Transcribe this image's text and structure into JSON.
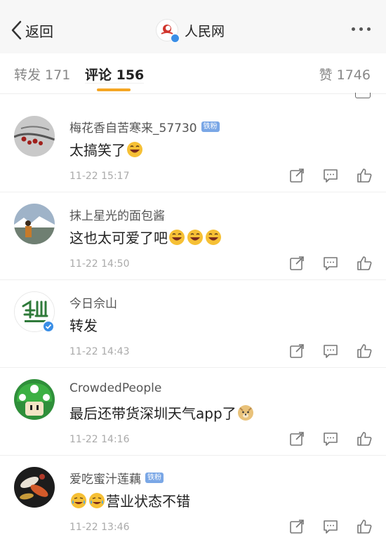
{
  "nav": {
    "back_label": "返回",
    "brand_name": "人民网"
  },
  "tabs": {
    "repost": "转发 171",
    "comment": "评论 156",
    "likes": "赞 1746"
  },
  "comments": [
    {
      "user": "梅花香自苦寒来_57730",
      "badge": "铁粉",
      "text": "太搞笑了",
      "emoji": [
        "laugh"
      ],
      "time": "11-22 15:17"
    },
    {
      "user": "抹上星光的面包酱",
      "badge": "",
      "text": "这也太可爱了吧",
      "emoji": [
        "laugh",
        "laugh",
        "laugh"
      ],
      "time": "11-22 14:50"
    },
    {
      "user": "今日佘山",
      "badge": "",
      "text": "转发",
      "emoji": [],
      "time": "11-22 14:43",
      "verified": true
    },
    {
      "user": "CrowdedPeople",
      "badge": "",
      "text": "最后还带货深圳天气app了",
      "emoji": [
        "doge"
      ],
      "time": "11-22 14:16"
    },
    {
      "user": "爱吃蜜汁莲藕",
      "badge": "铁粉",
      "text": "营业状态不错",
      "emoji_before": [
        "cry-laugh",
        "cry-laugh"
      ],
      "time": "11-22 13:46"
    }
  ],
  "icons": {
    "actions": [
      "share-icon",
      "comment-icon",
      "like-icon"
    ]
  },
  "colors": {
    "accent": "#f5a623",
    "badge_blue": "#7aa7e6",
    "verified_blue": "#3a8ee6"
  }
}
